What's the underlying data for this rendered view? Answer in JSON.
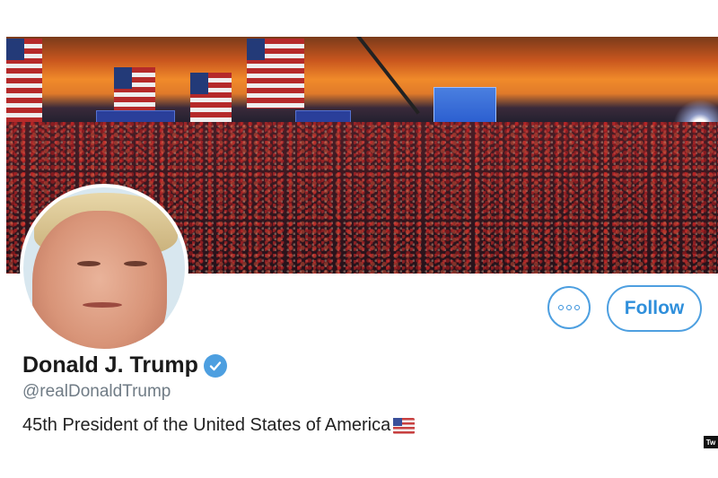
{
  "profile": {
    "name": "Donald J. Trump",
    "handle": "@realDonaldTrump",
    "bio": "45th President of the United States of America",
    "verified": true
  },
  "actions": {
    "follow_label": "Follow",
    "more_icon": "more-options-icon"
  },
  "icons": {
    "verified": "verified-badge-icon",
    "bio_flag": "us-flag-emoji"
  },
  "watermark": "Tw",
  "colors": {
    "accent": "#4d9fe0",
    "name_text": "#1a1a1a",
    "handle_text": "#6f7b85"
  }
}
